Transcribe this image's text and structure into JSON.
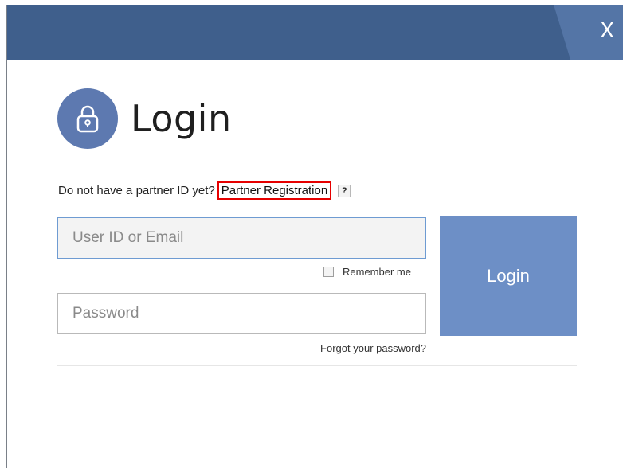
{
  "window": {
    "close_label": "X"
  },
  "header": {
    "title": "Login",
    "icon": "lock-icon"
  },
  "registration": {
    "prompt": "Do not have a partner ID yet?",
    "link_label": "Partner Registration",
    "help_label": "?"
  },
  "form": {
    "userid_placeholder": "User ID or Email",
    "userid_value": "",
    "remember_label": "Remember me",
    "remember_checked": false,
    "password_placeholder": "Password",
    "password_value": "",
    "forgot_label": "Forgot your password?",
    "login_button_label": "Login"
  },
  "colors": {
    "titlebar": "#3f5f8c",
    "close_tab": "#5475a6",
    "accent": "#5d79b0",
    "login_button": "#6d8fc6",
    "highlight_box": "#e60000"
  }
}
